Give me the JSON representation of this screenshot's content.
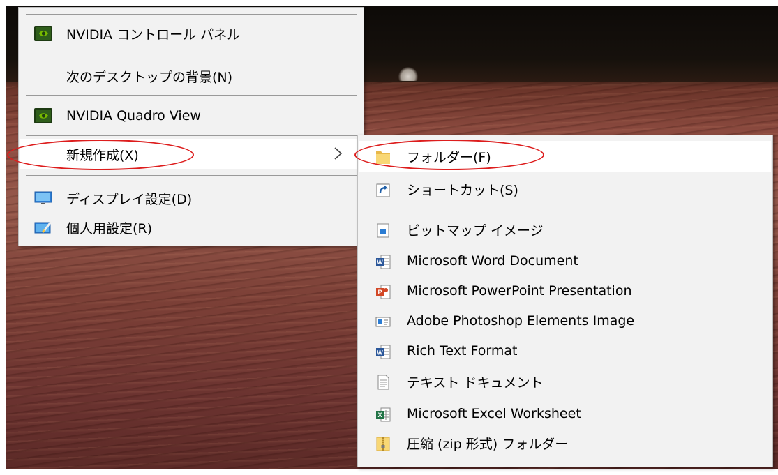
{
  "main_menu": {
    "items": [
      {
        "label": "NVIDIA コントロール パネル",
        "icon": "nvidia-icon"
      },
      {
        "label": "次のデスクトップの背景(N)",
        "icon": ""
      },
      {
        "label": "NVIDIA Quadro View",
        "icon": "nvidia-icon"
      },
      {
        "label": "新規作成(X)",
        "icon": "",
        "submenu_arrow": "chevron-right-icon"
      },
      {
        "label": "ディスプレイ設定(D)",
        "icon": "display-icon"
      },
      {
        "label": "個人用設定(R)",
        "icon": "personalize-icon"
      }
    ]
  },
  "sub_menu": {
    "items": [
      {
        "label": "フォルダー(F)",
        "icon": "folder-icon"
      },
      {
        "label": "ショートカット(S)",
        "icon": "shortcut-icon"
      },
      {
        "label": "ビットマップ イメージ",
        "icon": "bitmap-icon"
      },
      {
        "label": "Microsoft Word Document",
        "icon": "word-icon"
      },
      {
        "label": "Microsoft PowerPoint Presentation",
        "icon": "powerpoint-icon"
      },
      {
        "label": "Adobe Photoshop Elements Image",
        "icon": "photoshop-elements-icon"
      },
      {
        "label": "Rich Text Format",
        "icon": "rtf-icon"
      },
      {
        "label": "テキスト ドキュメント",
        "icon": "text-document-icon"
      },
      {
        "label": "Microsoft Excel Worksheet",
        "icon": "excel-icon"
      },
      {
        "label": "圧縮 (zip 形式) フォルダー",
        "icon": "zip-folder-icon"
      }
    ]
  },
  "colors": {
    "menu_background": "#f2f2f2",
    "hover_background": "#ffffff",
    "annotation_ellipse": "#dd1d1d",
    "nvidia_green": "#76b900"
  }
}
